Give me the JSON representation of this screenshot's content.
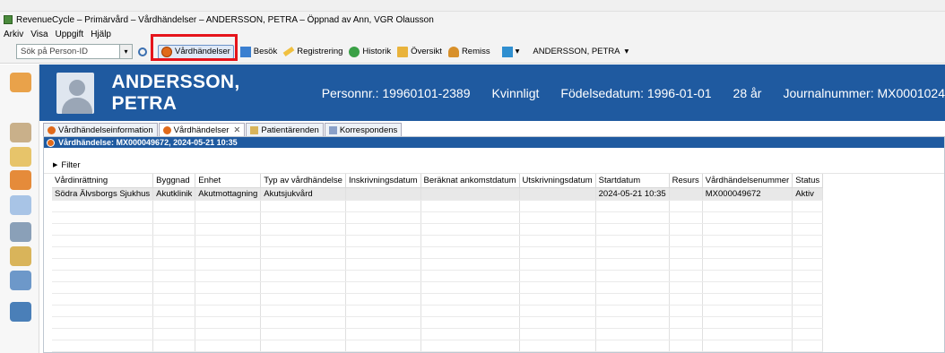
{
  "app_title": "RevenueCycle – Primärvård – Vårdhändelser – ANDERSSON, PETRA – Öppnad av Ann, VGR Olausson",
  "menu": [
    "Arkiv",
    "Visa",
    "Uppgift",
    "Hjälp"
  ],
  "toolbar": {
    "search_placeholder": "Sök på Person-ID",
    "buttons": [
      {
        "label": "Vårdhändelser",
        "icon": "clock-icon"
      },
      {
        "label": "Besök",
        "icon": "visit-icon"
      },
      {
        "label": "Registrering",
        "icon": "pencil-icon"
      },
      {
        "label": "Historik",
        "icon": "history-icon"
      },
      {
        "label": "Översikt",
        "icon": "overview-icon"
      },
      {
        "label": "Remiss",
        "icon": "referral-icon"
      }
    ],
    "patient_selector": "ANDERSSON, PETRA"
  },
  "patient": {
    "name": "ANDERSSON, PETRA",
    "personnr": "Personnr.: 19960101-2389",
    "gender": "Kvinnligt",
    "dob": "Födelsedatum: 1996-01-01",
    "age": "28 år",
    "journal": "Journalnummer: MX0001024"
  },
  "tabs": [
    {
      "label": "Vårdhändelseinformation"
    },
    {
      "label": "Vårdhändelser",
      "active": true
    },
    {
      "label": "Patientärenden"
    },
    {
      "label": "Korrespondens"
    }
  ],
  "panel": {
    "title": "Vårdhändelse: MX000049672, 2024-05-21 10:35",
    "filter_label": "Filter"
  },
  "table": {
    "columns": [
      "Vårdinrättning",
      "Byggnad",
      "Enhet",
      "Typ av vårdhändelse",
      "Inskrivningsdatum",
      "Beräknat ankomstdatum",
      "Utskrivningsdatum",
      "Startdatum",
      "Resurs",
      "Vårdhändelsenummer",
      "Status"
    ],
    "rows": [
      [
        "Södra Älvsborgs Sjukhus",
        "Akutklinik",
        "Akutmottagning",
        "Akutsjukvård",
        "",
        "",
        "",
        "2024-05-21 10:35",
        "",
        "MX000049672",
        "Aktiv"
      ]
    ]
  },
  "colors": {
    "banner": "#1f5aa0",
    "highlight": "#e5141b"
  }
}
